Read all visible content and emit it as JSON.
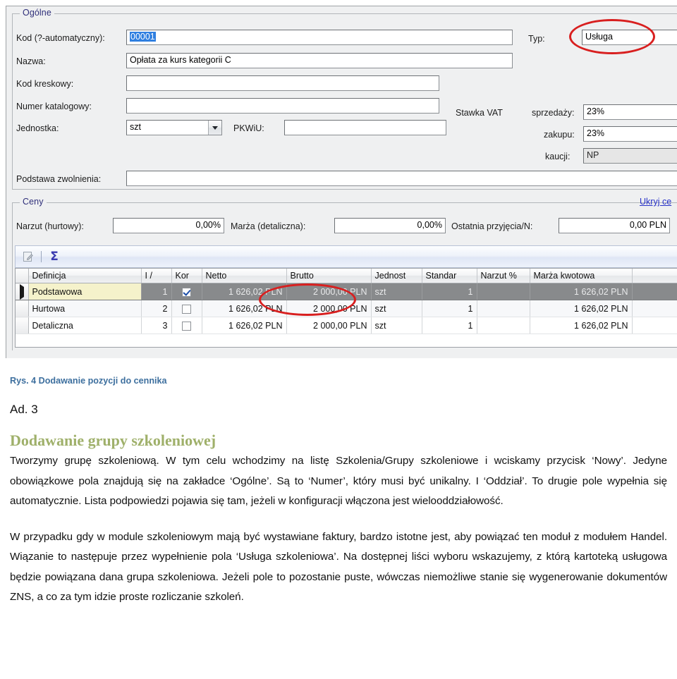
{
  "screenshot": {
    "general_group": {
      "legend": "Ogólne",
      "fields": [
        {
          "label": "Kod (?-automatyczny):",
          "value": "00001",
          "selected": true
        },
        {
          "label": "Nazwa:",
          "value": "Opłata za kurs kategorii C"
        },
        {
          "label": "Kod kreskowy:",
          "value": ""
        },
        {
          "label": "Numer katalogowy:",
          "value": ""
        },
        {
          "label": "Jednostka:",
          "value": "szt"
        },
        {
          "label": "PKWiU:",
          "value": ""
        },
        {
          "label": "Podstawa zwolnienia:",
          "value": ""
        }
      ],
      "type_label": "Typ:",
      "type_value": "Usługa",
      "vat_group_label": "Stawka VAT",
      "vat_rows": [
        {
          "label": "sprzedaży:",
          "value": "23%",
          "readonly": false
        },
        {
          "label": "zakupu:",
          "value": "23%",
          "readonly": false
        },
        {
          "label": "kaucji:",
          "value": "NP",
          "readonly": true
        }
      ]
    },
    "prices_group": {
      "legend": "Ceny",
      "hide_link": "Ukryj ce",
      "fields": [
        {
          "label": "Narzut (hurtowy):",
          "value": "0,00%"
        },
        {
          "label": "Marża (detaliczna):",
          "value": "0,00%"
        },
        {
          "label": "Ostatnia przyjęcia/N:",
          "value": "0,00 PLN"
        }
      ],
      "toolbar": {
        "edit_icon": "pencil-edit-icon",
        "sum_icon": "sigma-sum-icon",
        "sum_glyph": "Σ"
      },
      "grid": {
        "columns": [
          "Definicja",
          "I /",
          "Kor",
          "Netto",
          "Brutto",
          "Jednost",
          "Standar",
          "Narzut %",
          "Marża kwotowa",
          ""
        ],
        "rows": [
          {
            "selected": true,
            "indicator": "▶",
            "definicja": "Podstawowa",
            "lp": "1",
            "kor": true,
            "netto": "1 626,02 PLN",
            "brutto": "2 000,00 PLN",
            "jednostka": "szt",
            "standard": "1",
            "narzut": "",
            "marza": "1 626,02 PLN"
          },
          {
            "selected": false,
            "indicator": "",
            "definicja": "Hurtowa",
            "lp": "2",
            "kor": false,
            "netto": "1 626,02 PLN",
            "brutto": "2 000,00 PLN",
            "jednostka": "szt",
            "standard": "1",
            "narzut": "",
            "marza": "1 626,02 PLN"
          },
          {
            "selected": false,
            "indicator": "",
            "definicja": "Detaliczna",
            "lp": "3",
            "kor": false,
            "netto": "1 626,02 PLN",
            "brutto": "2 000,00 PLN",
            "jednostka": "szt",
            "standard": "1",
            "narzut": "",
            "marza": "1 626,02 PLN"
          }
        ]
      }
    },
    "annotations": {
      "color": "#d81f1f",
      "shapes": [
        "oval-around-typ-field",
        "oval-around-brutto-cell"
      ]
    }
  },
  "document": {
    "figure_caption": "Rys. 4 Dodawanie pozycji do cennika",
    "ad_line": "Ad. 3",
    "section_heading": "Dodawanie grupy szkoleniowej",
    "paragraph_1": "Tworzymy grupę szkoleniową. W tym celu wchodzimy na listę Szkolenia/Grupy szkoleniowe i wciskamy przycisk ‘Nowy’. Jedyne obowiązkowe pola znajdują się na zakładce ‘Ogólne’. Są to ‘Numer’, który musi być unikalny. I ‘Oddział’. To drugie pole wypełnia się automatycznie. Lista podpowiedzi pojawia się tam, jeżeli w konfiguracji włączona jest wielooddziałowość.",
    "paragraph_2": "W przypadku gdy w module szkoleniowym mają być wystawiane faktury, bardzo istotne jest, aby powiązać ten moduł z modułem Handel. Wiązanie to następuje przez wypełnienie pola ‘Usługa szkoleniowa’. Na dostępnej liści wyboru wskazujemy, z którą kartoteką usługowa będzie powiązana dana grupa szkoleniowa. Jeżeli pole to pozostanie puste, wówczas niemożliwe stanie się wygenerowanie dokumentów ZNS, a co za tym idzie proste rozliczanie szkoleń."
  },
  "colors": {
    "caption_blue": "#3d6f9e",
    "heading_green": "#9fb06a",
    "annotation_red": "#d81f1f",
    "selection_blue": "#2f7fe0",
    "link_blue": "#2731c8"
  }
}
